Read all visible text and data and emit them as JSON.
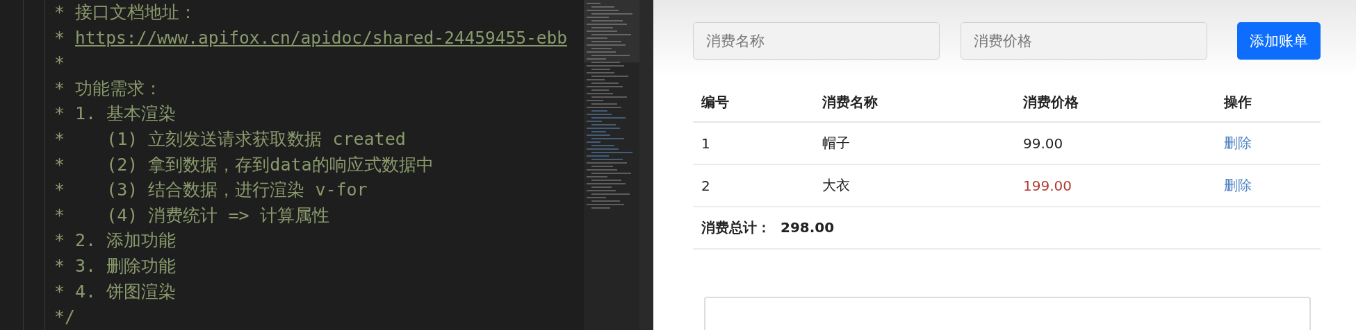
{
  "editor": {
    "lines": [
      {
        "kind": "comment",
        "star": "*",
        "text": "接口文档地址："
      },
      {
        "kind": "link",
        "star": "*",
        "text": "https://www.apifox.cn/apidoc/shared-24459455-ebb"
      },
      {
        "star": "*"
      },
      {
        "kind": "comment",
        "star": "*",
        "text": "功能需求："
      },
      {
        "kind": "comment",
        "star": "*",
        "text": "1. 基本渲染"
      },
      {
        "kind": "comment",
        "star": "*",
        "text": "   (1) 立刻发送请求获取数据 created"
      },
      {
        "kind": "comment",
        "star": "*",
        "text": "   (2) 拿到数据，存到data的响应式数据中"
      },
      {
        "kind": "comment",
        "star": "*",
        "text": "   (3) 结合数据，进行渲染 v-for"
      },
      {
        "kind": "comment",
        "star": "*",
        "text": "   (4) 消费统计 => 计算属性"
      },
      {
        "kind": "comment",
        "star": "*",
        "text": "2. 添加功能"
      },
      {
        "kind": "comment",
        "star": "*",
        "text": "3. 删除功能"
      },
      {
        "kind": "comment",
        "star": "*",
        "text": "4. 饼图渲染"
      },
      {
        "star": "*/"
      }
    ]
  },
  "form": {
    "name_placeholder": "消费名称",
    "price_placeholder": "消费价格",
    "add_button": "添加账单"
  },
  "table": {
    "columns": [
      "编号",
      "消费名称",
      "消费价格",
      "操作"
    ],
    "rows": [
      {
        "id": "1",
        "name": "帽子",
        "price": "99.00",
        "highlight": false,
        "action": "删除"
      },
      {
        "id": "2",
        "name": "大衣",
        "price": "199.00",
        "highlight": true,
        "action": "删除"
      }
    ],
    "total_label": "消费总计：",
    "total_value": "298.00"
  }
}
